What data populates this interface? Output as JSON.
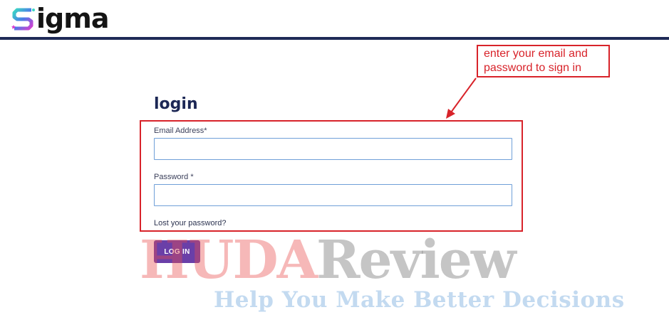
{
  "header": {
    "logo_text": "igma",
    "bar_color": "#1e2a57"
  },
  "login": {
    "title": "login",
    "email_label": "Email Address*",
    "email_value": "",
    "password_label": "Password *",
    "password_value": "",
    "lost_password_link": "Lost your password?",
    "submit_label": "LOG IN",
    "accent_color": "#6a3fa8"
  },
  "annotation": {
    "callout_lines": [
      "enter your email and",
      "password to sign in"
    ],
    "color": "#d8232a"
  },
  "watermark": {
    "part1": "HUDA",
    "part2": "Review",
    "tagline": "Help You Make Better Decisions"
  },
  "icons": {
    "logo": "sigma-s-logo-icon",
    "arrow": "annotation-arrow-icon"
  }
}
